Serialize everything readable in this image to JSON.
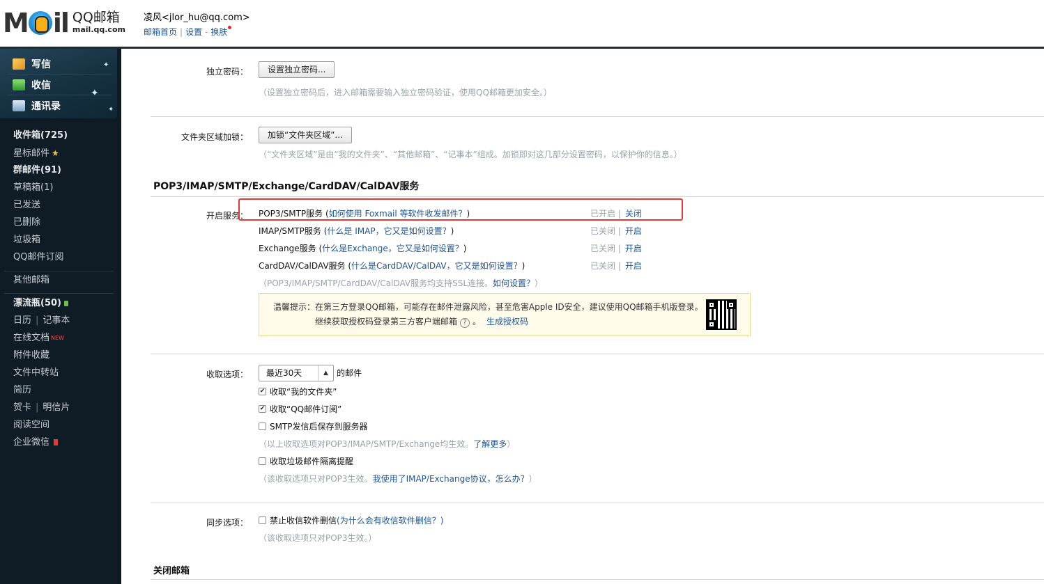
{
  "header": {
    "logo_mail": "M",
    "logo_il": "il",
    "logo_cn": "QQ邮箱",
    "logo_url": "mail.qq.com",
    "user_name": "凌风",
    "user_email": "<jlor_hu@qq.com>",
    "links": [
      "邮箱首页",
      "设置",
      "换肤"
    ],
    "sep1": "|",
    "sep2": "-"
  },
  "sidebar": {
    "actions": [
      "写信",
      "收信",
      "通讯录"
    ],
    "items": {
      "inbox": "收件箱(725)",
      "starred": "星标邮件",
      "group": "群邮件(91)",
      "drafts": "草稿箱(1)",
      "sent": "已发送",
      "deleted": "已删除",
      "trash": "垃圾箱",
      "subscribe": "QQ邮件订阅",
      "other": "其他邮箱",
      "bottle": "漂流瓶(50)",
      "calendar": "日历",
      "notes": "记事本",
      "docs": "在线文档",
      "docs_new": "NEW",
      "attach": "附件收藏",
      "transfer": "文件中转站",
      "resume": "简历",
      "cards": "贺卡",
      "postcard": "明信片",
      "reading": "阅读空间",
      "wework": "企业微信"
    },
    "pipe": "|"
  },
  "content": {
    "pwd": {
      "label": "独立密码：",
      "button": "设置独立密码...",
      "hint": "（设置独立密码后，进入邮箱需要输入独立密码验证，使用QQ邮箱更加安全。）"
    },
    "folder": {
      "label": "文件夹区域加锁：",
      "button": "加锁“文件夹区域”...",
      "hint": "（“文件夹区域”是由“我的文件夹”、“其他邮箱”、“记事本”组成。加锁即对这几部分设置密码，以保护你的信息。）"
    },
    "service_title": "POP3/IMAP/SMTP/Exchange/CardDAV/CalDAV服务",
    "service_label": "开启服务：",
    "services": [
      {
        "name": "POP3/SMTP服务 (",
        "link": "如何使用 Foxmail 等软件收发邮件？",
        "close": ")",
        "status": "已开启 |",
        "action": "关闭"
      },
      {
        "name": "IMAP/SMTP服务 (",
        "link": "什么是 IMAP，它又是如何设置？",
        "close": ")",
        "status": "已关闭 |",
        "action": "开启"
      },
      {
        "name": "Exchange服务 (",
        "link": "什么是Exchange，它又是如何设置？",
        "close": ")",
        "status": "已关闭 |",
        "action": "开启"
      },
      {
        "name": "CardDAV/CalDAV服务 (",
        "link": "什么是CardDAV/CalDAV，它又是如何设置？",
        "close": ")",
        "status": "已关闭 |",
        "action": "开启"
      }
    ],
    "ssl_hint": "（POP3/IMAP/SMTP/CardDAV/CalDAV服务均支持SSL连接。",
    "ssl_link": "如何设置？",
    "ssl_close": "）",
    "tip_line1": "温馨提示：在第三方登录QQ邮箱，可能存在邮件泄露风险，甚至危害Apple ID安全，建议使用QQ邮箱手机版登录。",
    "tip_line2": "继续获取授权码登录第三方客户端邮箱",
    "tip_q": "?",
    "tip_period": "。",
    "tip_link": "生成授权码",
    "receive": {
      "label": "收取选项：",
      "select_value": "最近30天",
      "select_suffix": "的邮件",
      "opt1": "收取“我的文件夹”",
      "opt2": "收取“QQ邮件订阅”",
      "opt3": "SMTP发信后保存到服务器",
      "hint1": "（以上收取选项对POP3/IMAP/SMTP/Exchange均生效。",
      "hint1_link": "了解更多",
      "hint1_close": "）",
      "opt4": "收取垃圾邮件隔离提醒",
      "hint2": "（该收取选项只对POP3生效。",
      "hint2_link": "我使用了IMAP/Exchange协议，怎么办？",
      "hint2_close": "）"
    },
    "sync": {
      "label": "同步选项：",
      "opt": "禁止收信软件删信",
      "link": "(为什么会有收信软件删信？)",
      "hint": "（该收取选项只对POP3生效。）"
    },
    "close_title": "关闭邮箱"
  }
}
